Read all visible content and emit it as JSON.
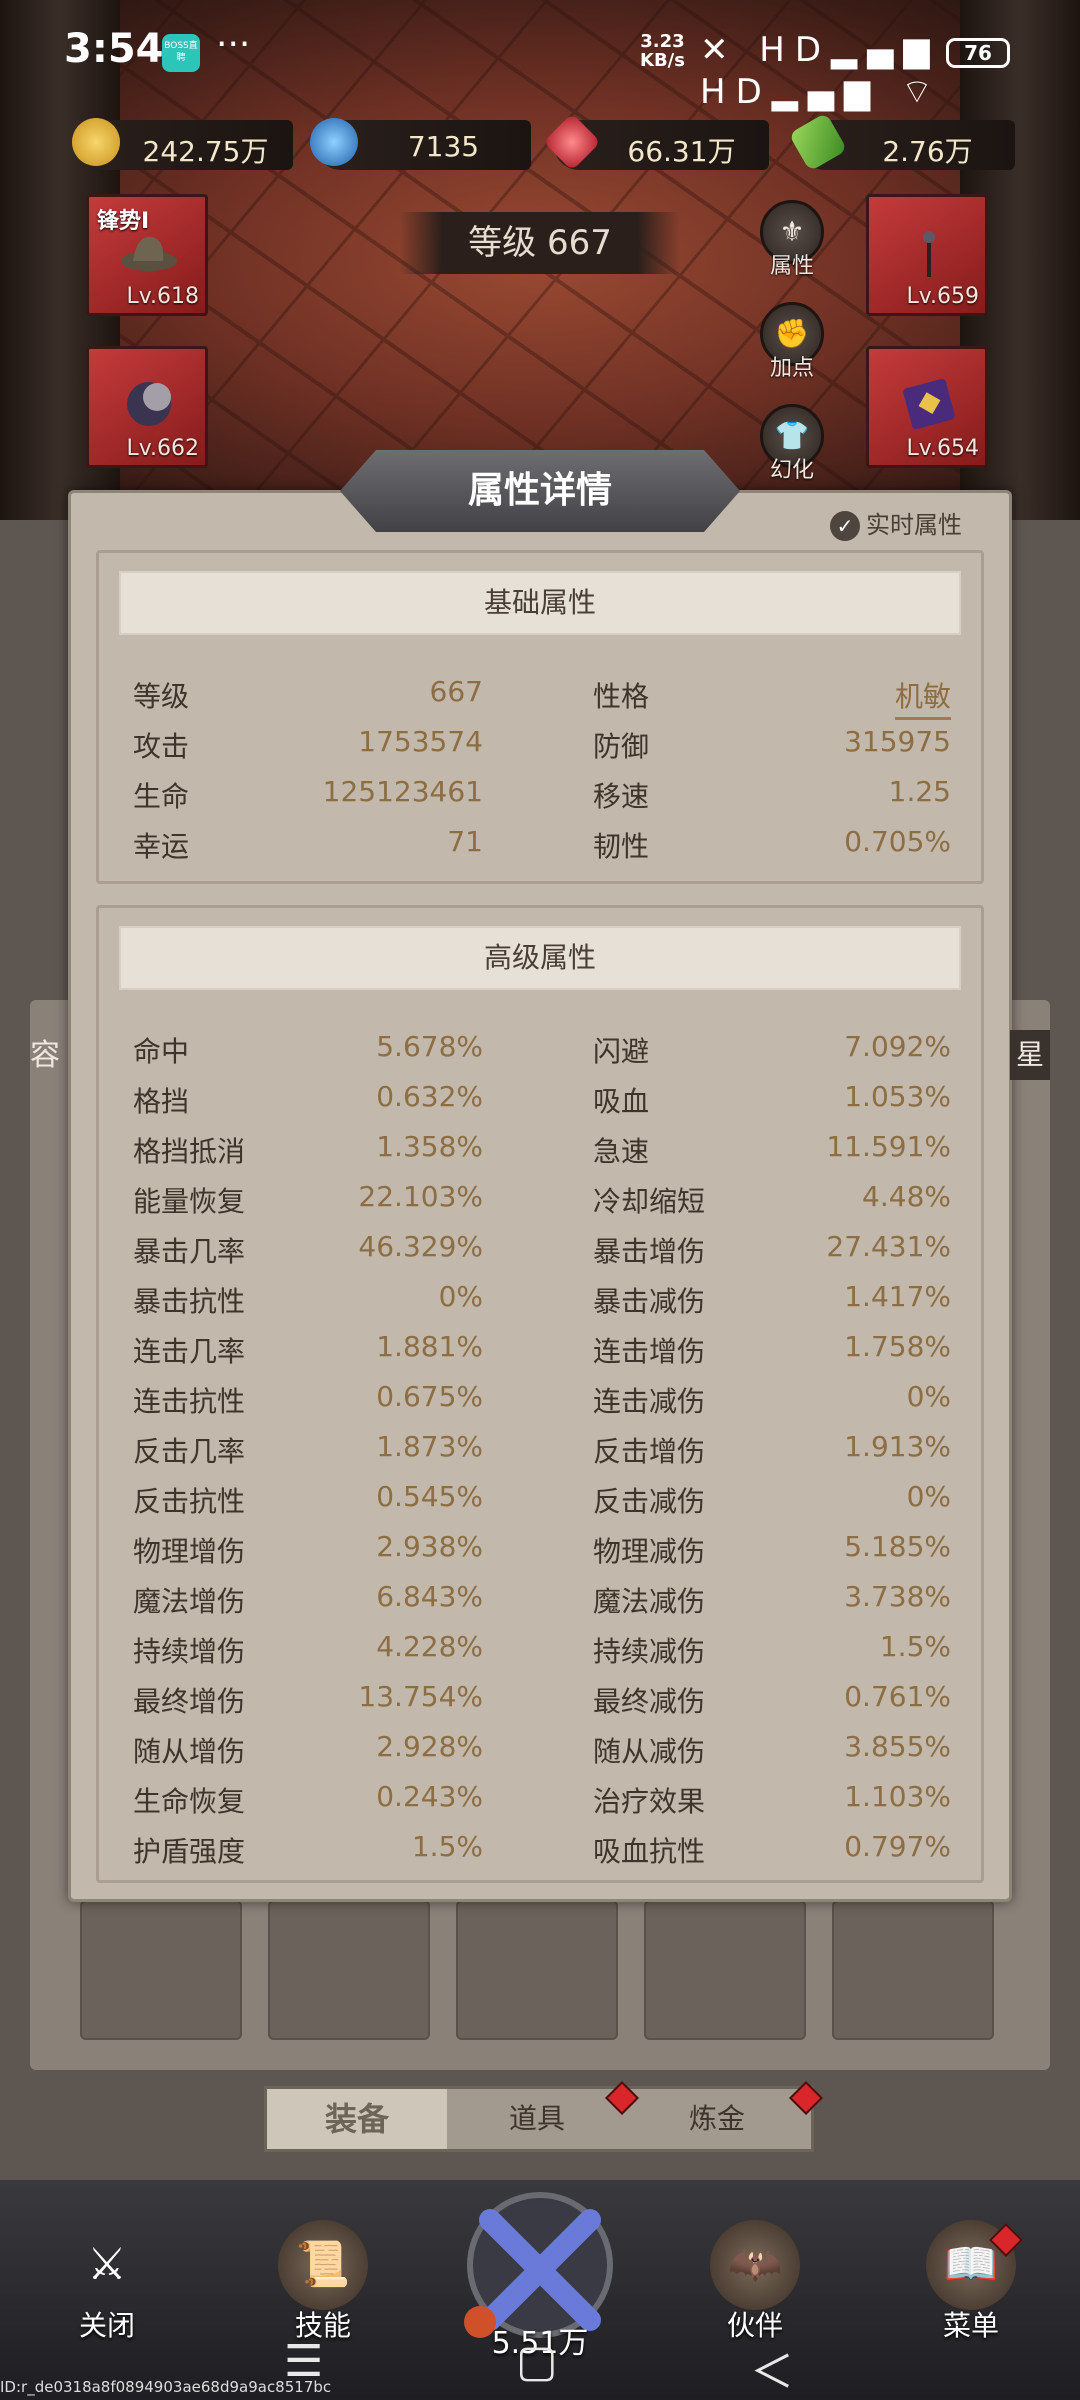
{
  "status_bar": {
    "time": "3:54",
    "app_badge": "BOSS直聘",
    "more": "···",
    "net_speed": "3.23",
    "net_unit": "KB/s",
    "icons": "✕ HD▂▄▆ HD▂▄▆ ⌔",
    "battery": "76"
  },
  "currencies": [
    {
      "name": "gold",
      "value": "242.75万",
      "color": "#e2b23a"
    },
    {
      "name": "blue-gem",
      "value": "7135",
      "color": "#3a8ad6"
    },
    {
      "name": "red-gem",
      "value": "66.31万",
      "color": "#d23a4a"
    },
    {
      "name": "cash",
      "value": "2.76万",
      "color": "#6ab43a"
    }
  ],
  "level_label": "等级 667",
  "equipment": [
    {
      "name": "锋势I",
      "level": "Lv.618"
    },
    {
      "name": "",
      "level": "Lv.662"
    },
    {
      "name": "",
      "level": "Lv.659"
    },
    {
      "name": "",
      "level": "Lv.654"
    }
  ],
  "side_buttons": [
    "属性",
    "加点",
    "幻化"
  ],
  "panel": {
    "title": "属性详情",
    "realtime_label": "实时属性",
    "basic": {
      "header": "基础属性",
      "rows": [
        [
          "等级",
          "667",
          "性格",
          "机敏"
        ],
        [
          "攻击",
          "1753574",
          "防御",
          "315975"
        ],
        [
          "生命",
          "125123461",
          "移速",
          "1.25"
        ],
        [
          "幸运",
          "71",
          "韧性",
          "0.705%"
        ]
      ]
    },
    "advanced": {
      "header": "高级属性",
      "rows": [
        [
          "命中",
          "5.678%",
          "闪避",
          "7.092%"
        ],
        [
          "格挡",
          "0.632%",
          "吸血",
          "1.053%"
        ],
        [
          "格挡抵消",
          "1.358%",
          "急速",
          "11.591%"
        ],
        [
          "能量恢复",
          "22.103%",
          "冷却缩短",
          "4.48%"
        ],
        [
          "暴击几率",
          "46.329%",
          "暴击增伤",
          "27.431%"
        ],
        [
          "暴击抗性",
          "0%",
          "暴击减伤",
          "1.417%"
        ],
        [
          "连击几率",
          "1.881%",
          "连击增伤",
          "1.758%"
        ],
        [
          "连击抗性",
          "0.675%",
          "连击减伤",
          "0%"
        ],
        [
          "反击几率",
          "1.873%",
          "反击增伤",
          "1.913%"
        ],
        [
          "反击抗性",
          "0.545%",
          "反击减伤",
          "0%"
        ],
        [
          "物理增伤",
          "2.938%",
          "物理减伤",
          "5.185%"
        ],
        [
          "魔法增伤",
          "6.843%",
          "魔法减伤",
          "3.738%"
        ],
        [
          "持续增伤",
          "4.228%",
          "持续减伤",
          "1.5%"
        ],
        [
          "最终增伤",
          "13.754%",
          "最终减伤",
          "0.761%"
        ],
        [
          "随从增伤",
          "2.928%",
          "随从减伤",
          "3.855%"
        ],
        [
          "生命恢复",
          "0.243%",
          "治疗效果",
          "1.103%"
        ],
        [
          "护盾强度",
          "1.5%",
          "吸血抗性",
          "0.797%"
        ]
      ]
    }
  },
  "side_fragments": {
    "left": "容",
    "right": "星"
  },
  "tabs": [
    "装备",
    "道具",
    "炼金"
  ],
  "bottom_nav": {
    "close": "关闭",
    "skills": "技能",
    "center_value": "5.51万",
    "partner": "伙伴",
    "menu": "菜单"
  },
  "system_nav": {
    "menu": "☰",
    "home": "▢",
    "back": "＜"
  },
  "id_text": "ID:r_de0318a8f0894903ae68d9a9ac8517bc"
}
